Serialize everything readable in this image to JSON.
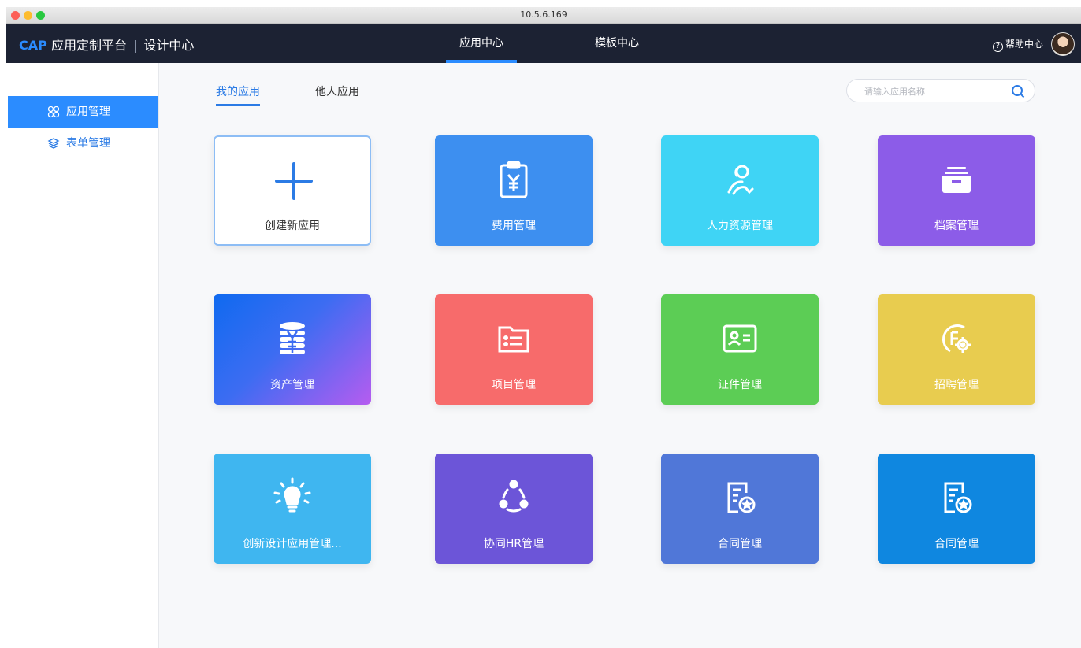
{
  "window": {
    "url": "10.5.6.169"
  },
  "topnav": {
    "brand_cap": "CAP",
    "brand_name": "应用定制平台",
    "brand_sep": "|",
    "brand_section": "设计中心",
    "tabs": [
      {
        "label": "应用中心",
        "active": true
      },
      {
        "label": "模板中心",
        "active": false
      }
    ],
    "help_label": "帮助中心",
    "help_icon": "?"
  },
  "sidebar": {
    "items": [
      {
        "label": "应用管理",
        "icon": "apps-grid-icon",
        "active": true
      },
      {
        "label": "表单管理",
        "icon": "layers-icon",
        "active": false
      }
    ]
  },
  "main": {
    "subtabs": [
      {
        "label": "我的应用",
        "active": true
      },
      {
        "label": "他人应用",
        "active": false
      }
    ],
    "search": {
      "placeholder": "请输入应用名称",
      "value": ""
    },
    "cards": [
      {
        "label": "创建新应用",
        "icon": "plus-icon",
        "color": "#ffffff"
      },
      {
        "label": "费用管理",
        "icon": "yen-clipboard-icon",
        "color": "#3d8ff0"
      },
      {
        "label": "人力资源管理",
        "icon": "people-icon",
        "color": "#3fd4f5"
      },
      {
        "label": "档案管理",
        "icon": "archive-box-icon",
        "color": "#8c5ce8"
      },
      {
        "label": "资产管理",
        "icon": "coin-stack-icon",
        "color": "#3d6cf2"
      },
      {
        "label": "项目管理",
        "icon": "folder-list-icon",
        "color": "#f76b6b"
      },
      {
        "label": "证件管理",
        "icon": "id-card-icon",
        "color": "#5ccd55"
      },
      {
        "label": "招聘管理",
        "icon": "recruit-gear-icon",
        "color": "#e8cc4f"
      },
      {
        "label": "创新设计应用管理...",
        "icon": "lightbulb-icon",
        "color": "#3fb6f0"
      },
      {
        "label": "协同HR管理",
        "icon": "collaboration-icon",
        "color": "#6c55d8"
      },
      {
        "label": "合同管理",
        "icon": "contract-icon",
        "color": "#5077d8"
      },
      {
        "label": "合同管理",
        "icon": "contract-icon",
        "color": "#0f87e0"
      }
    ]
  }
}
